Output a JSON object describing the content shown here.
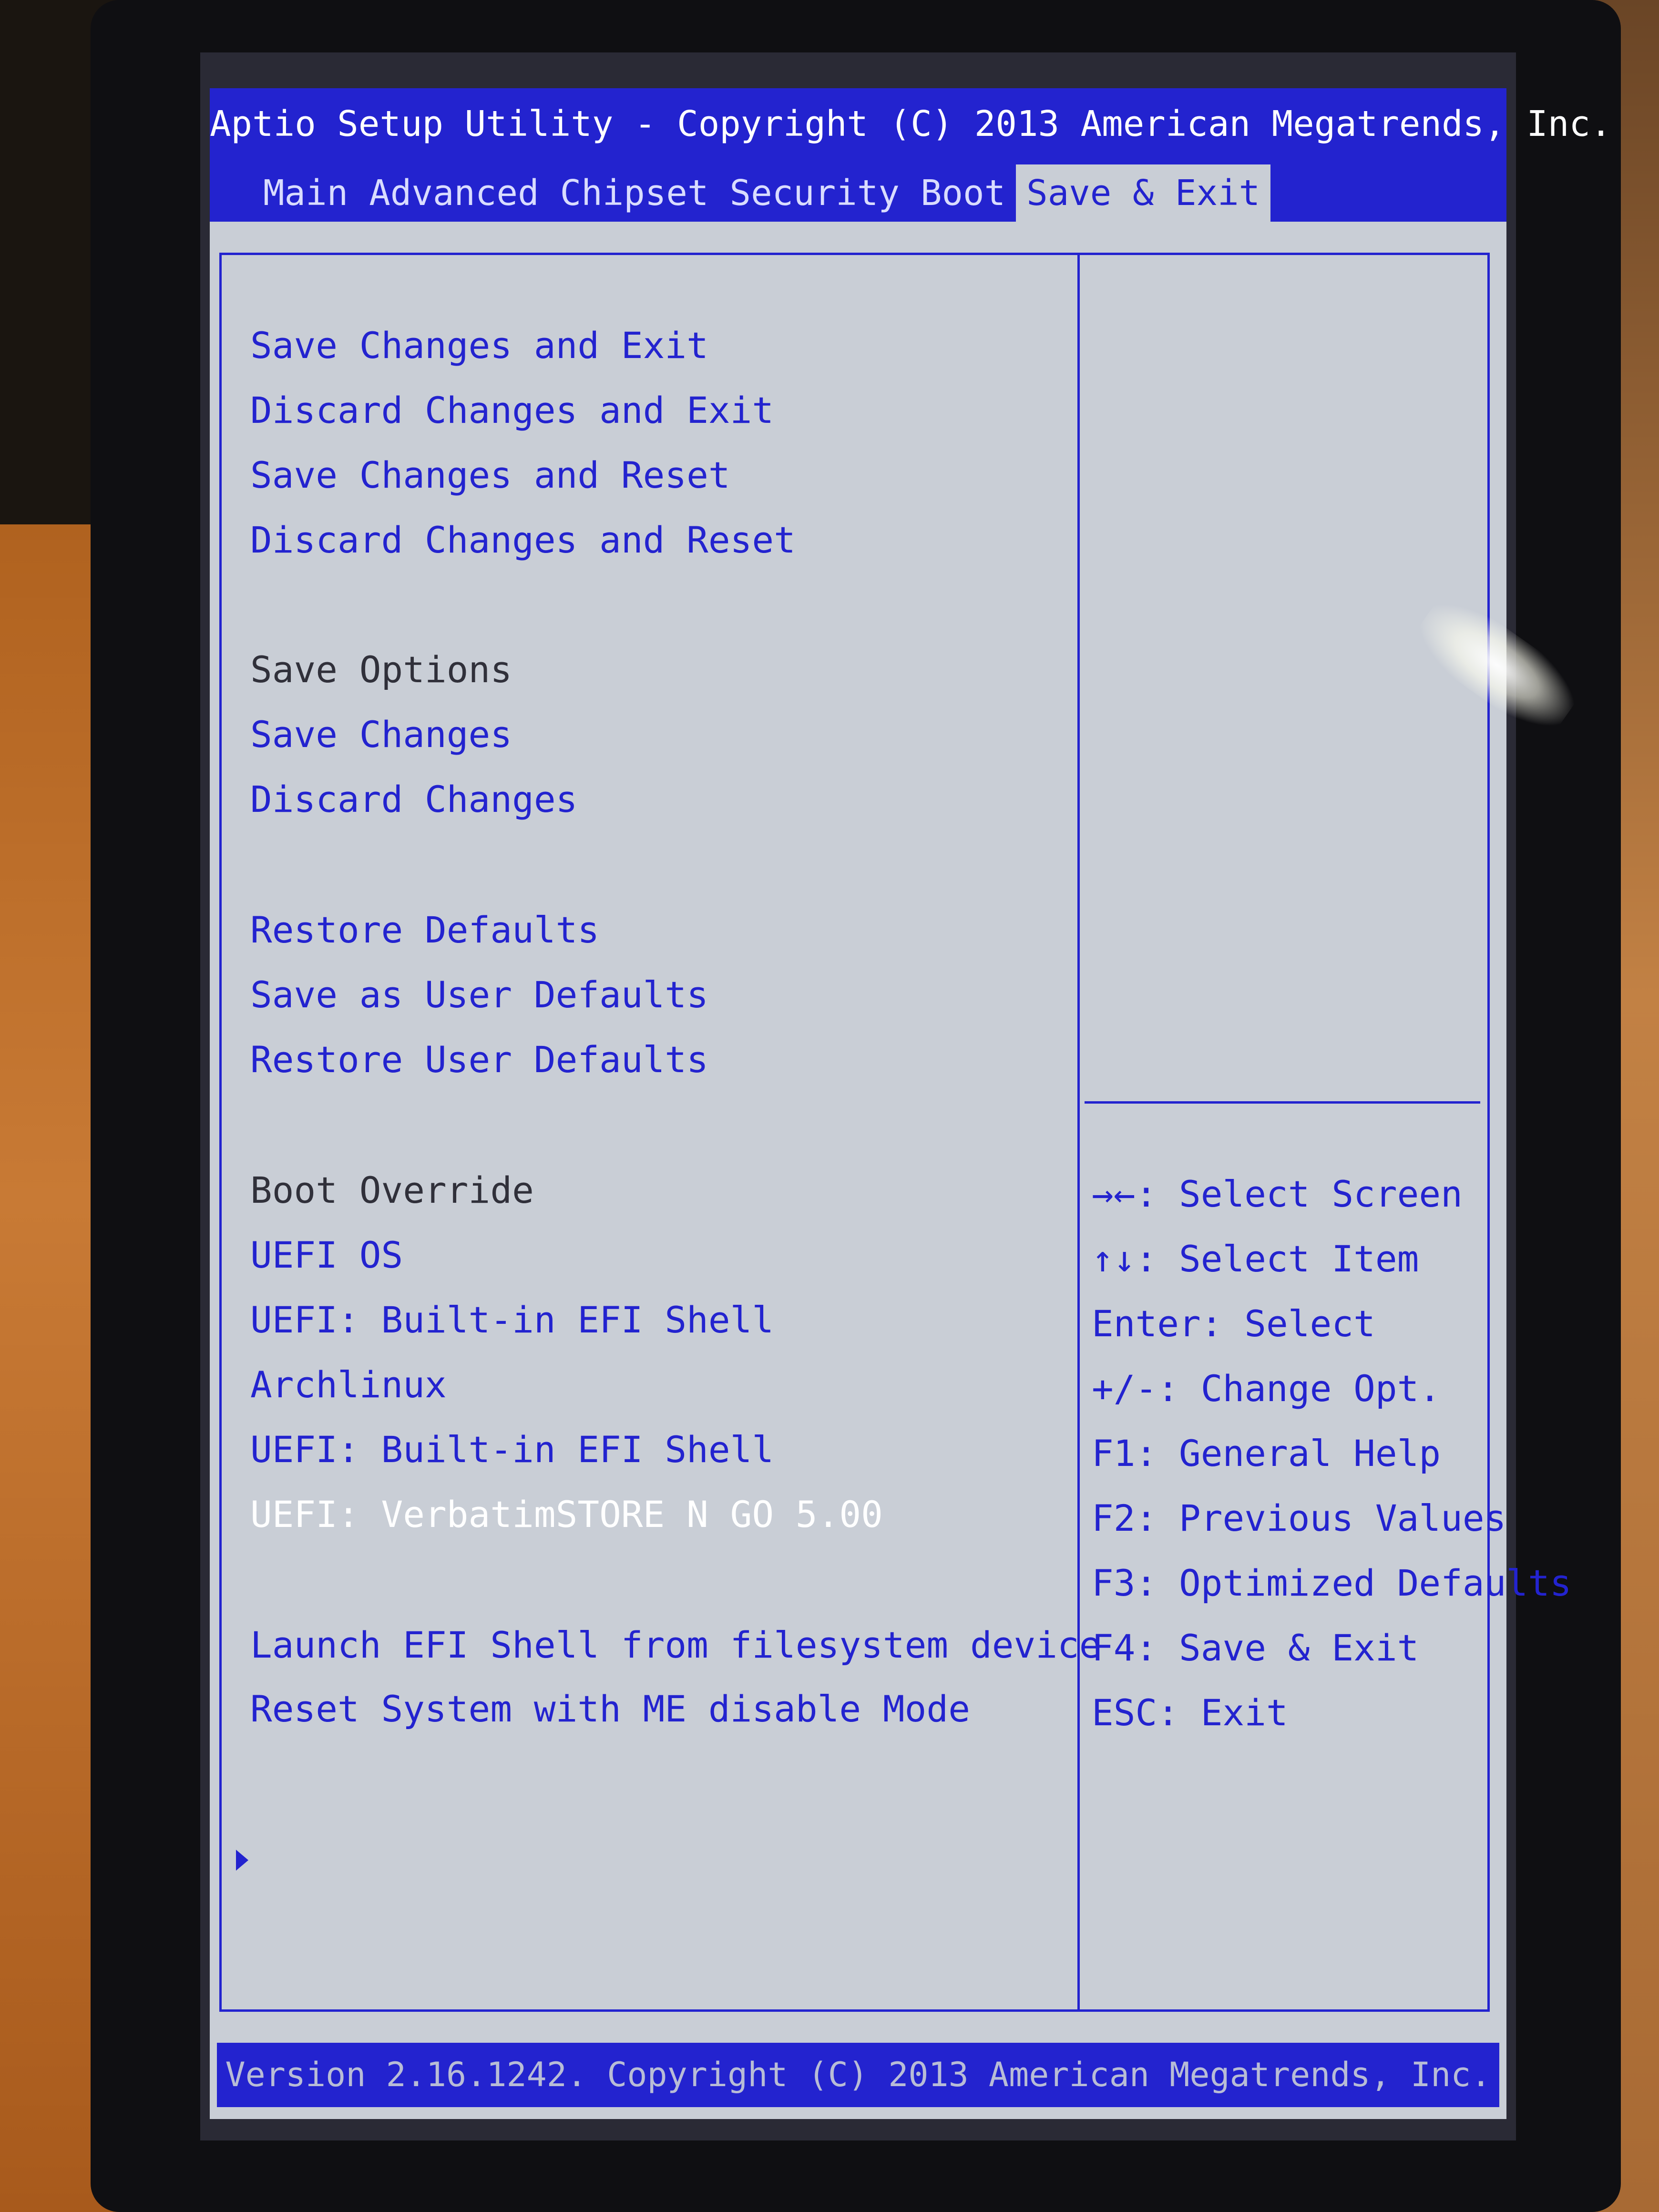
{
  "title_bar": {
    "title": "Aptio Setup Utility - Copyright (C) 2013 American Megatrends, Inc."
  },
  "tabs": [
    {
      "label": "Main",
      "active": false
    },
    {
      "label": "Advanced",
      "active": false
    },
    {
      "label": "Chipset",
      "active": false
    },
    {
      "label": "Security",
      "active": false
    },
    {
      "label": "Boot",
      "active": false
    },
    {
      "label": "Save & Exit",
      "active": true
    }
  ],
  "menu": {
    "items": [
      {
        "label": "Save Changes and Exit",
        "kind": "action"
      },
      {
        "label": "Discard Changes and Exit",
        "kind": "action"
      },
      {
        "label": "Save Changes and Reset",
        "kind": "action"
      },
      {
        "label": "Discard Changes and Reset",
        "kind": "action"
      },
      {
        "label": "Save Options",
        "kind": "header"
      },
      {
        "label": "Save Changes",
        "kind": "action"
      },
      {
        "label": "Discard Changes",
        "kind": "action"
      },
      {
        "label": "Restore Defaults",
        "kind": "action"
      },
      {
        "label": "Save as User Defaults",
        "kind": "action"
      },
      {
        "label": "Restore User Defaults",
        "kind": "action"
      },
      {
        "label": "Boot Override",
        "kind": "header"
      },
      {
        "label": "UEFI OS",
        "kind": "action"
      },
      {
        "label": "UEFI: Built-in EFI Shell",
        "kind": "action"
      },
      {
        "label": "Archlinux",
        "kind": "action"
      },
      {
        "label": "UEFI: Built-in EFI Shell",
        "kind": "action"
      },
      {
        "label": "UEFI: VerbatimSTORE N GO 5.00",
        "kind": "selected"
      },
      {
        "label": "Launch EFI Shell from filesystem device",
        "kind": "action"
      },
      {
        "label": "Reset System with ME disable Mode",
        "kind": "submenu"
      }
    ]
  },
  "help": {
    "items": [
      {
        "key": "→←",
        "text": ": Select Screen"
      },
      {
        "key": "↑↓",
        "text": ": Select Item"
      },
      {
        "key": "Enter",
        "text": ": Select"
      },
      {
        "key": "+/-",
        "text": ": Change Opt."
      },
      {
        "key": "F1",
        "text": ": General Help"
      },
      {
        "key": "F2",
        "text": ": Previous Values"
      },
      {
        "key": "F3",
        "text": ": Optimized Defaults"
      },
      {
        "key": "F4",
        "text": ": Save & Exit"
      },
      {
        "key": "ESC",
        "text": ": Exit"
      }
    ]
  },
  "footer": {
    "text": "Version 2.16.1242. Copyright (C) 2013 American Megatrends, Inc."
  },
  "colors": {
    "bios_blue": "#2323cf",
    "bios_gray": "#c9ced6",
    "header_text": "#30303a",
    "selected_text": "#ffffff"
  }
}
